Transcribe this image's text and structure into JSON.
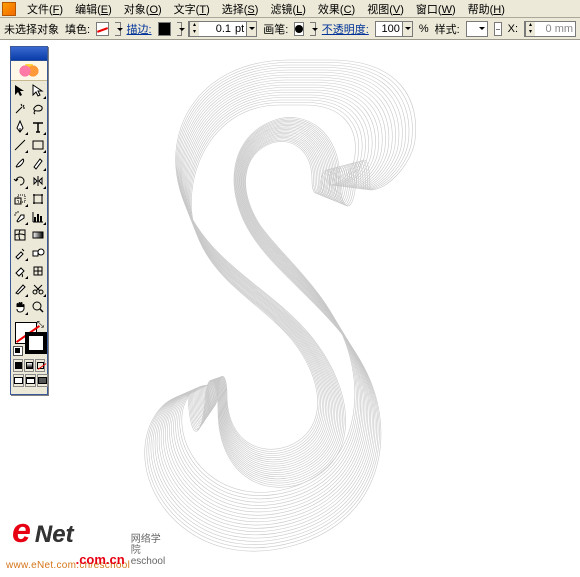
{
  "menu": {
    "file": {
      "label": "文件",
      "key": "F"
    },
    "edit": {
      "label": "编辑",
      "key": "E"
    },
    "object": {
      "label": "对象",
      "key": "O"
    },
    "type": {
      "label": "文字",
      "key": "T"
    },
    "select": {
      "label": "选择",
      "key": "S"
    },
    "filter": {
      "label": "滤镜",
      "key": "L"
    },
    "effect": {
      "label": "效果",
      "key": "C"
    },
    "view": {
      "label": "视图",
      "key": "V"
    },
    "window": {
      "label": "窗口",
      "key": "W"
    },
    "help": {
      "label": "帮助",
      "key": "H"
    }
  },
  "controlbar": {
    "selection_status": "未选择对象",
    "fill_label": "填色:",
    "stroke_label": "描边:",
    "stroke_weight": "0.1",
    "stroke_unit": "pt",
    "brush_label": "画笔:",
    "opacity_label": "不透明度:",
    "opacity_value": "100",
    "opacity_unit": "%",
    "style_label": "样式:",
    "x_label": "X:",
    "x_value": "0 mm"
  },
  "watermark": {
    "e": "e",
    "net": "Net",
    "com": ".com.cn",
    "cn1": "网络学院",
    "cn2": "eschool",
    "url": "www.eNet.com.cn/eschool"
  }
}
